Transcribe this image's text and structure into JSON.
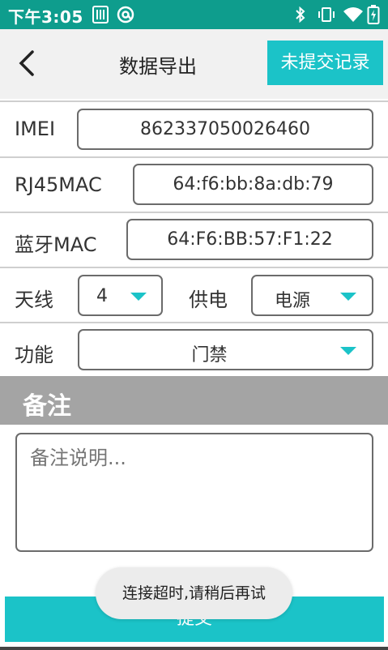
{
  "status_bar": {
    "time": "下午3:05",
    "icons": [
      "sim-card-icon",
      "circle-app-icon",
      "bluetooth-icon",
      "vibrate-icon",
      "wifi-icon",
      "battery-icon"
    ]
  },
  "header": {
    "title": "数据导出",
    "back_icon": "back-arrow-icon",
    "records_button": "未提交记录"
  },
  "form": {
    "imei": {
      "label": "IMEI",
      "value": "862337050026460"
    },
    "rj45mac": {
      "label": "RJ45MAC",
      "value": "64:f6:bb:8a:db:79"
    },
    "bluetooth_mac": {
      "label": "蓝牙MAC",
      "value": "64:F6:BB:57:F1:22"
    },
    "antenna": {
      "label": "天线",
      "value": "4"
    },
    "power": {
      "label": "供电",
      "value": "电源"
    },
    "function": {
      "label": "功能",
      "value": "门禁"
    }
  },
  "remarks": {
    "section_title": "备注",
    "placeholder": "备注说明..."
  },
  "submit_button": "提交",
  "toast": "连接超时,请稍后再试",
  "colors": {
    "accent": "#1bc3c8",
    "status_bar": "#0e9d8d",
    "section_header": "#a4a4a4"
  }
}
